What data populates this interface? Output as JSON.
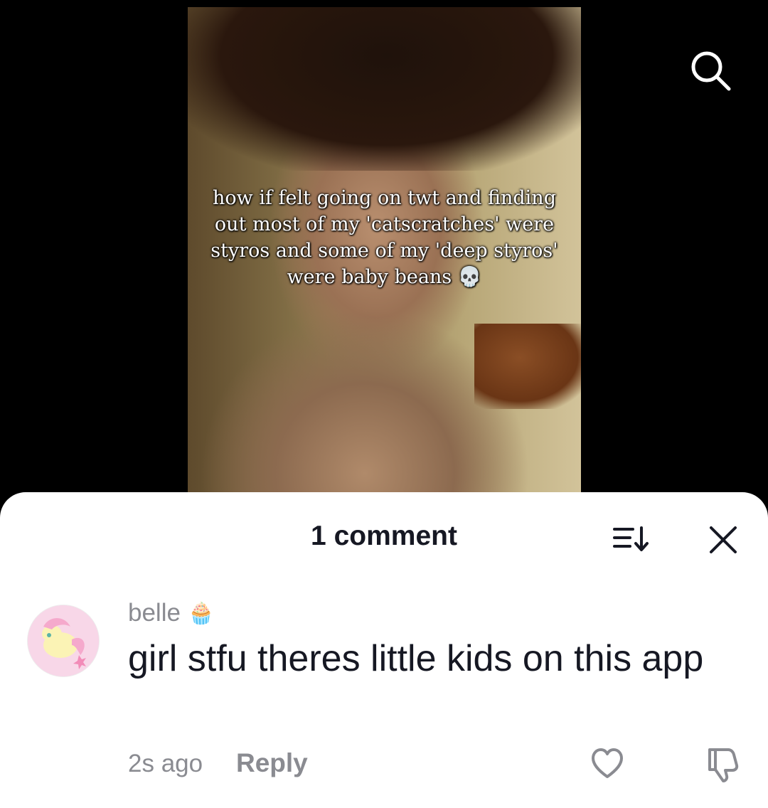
{
  "video": {
    "caption_lines": [
      "how if felt going on twt and finding",
      "out most of my 'catscratches' were",
      "styros and some of my 'deep styros'",
      "were baby beans 💀"
    ]
  },
  "top_bar": {
    "search_icon": "search-icon"
  },
  "comments_sheet": {
    "title": "1 comment",
    "sort_icon": "sort-icon",
    "close_icon": "close-icon",
    "comments": [
      {
        "username": "belle",
        "badge_emoji": "🧁",
        "text": "girl stfu theres little kids on this app",
        "time": "2s ago",
        "reply_label": "Reply"
      }
    ]
  },
  "colors": {
    "text_primary": "#161823",
    "text_secondary": "#8a8b91",
    "sheet_bg": "#ffffff"
  }
}
